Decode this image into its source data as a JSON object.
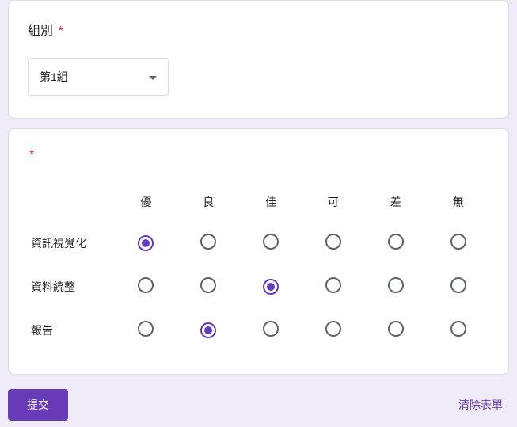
{
  "q1": {
    "label": "組別",
    "required": "*",
    "selected": "第1組"
  },
  "q2": {
    "label": "",
    "required": "*",
    "columns": [
      "優",
      "良",
      "佳",
      "可",
      "差",
      "無"
    ],
    "rows": [
      {
        "label": "資訊視覺化",
        "selected": 0
      },
      {
        "label": "資料統整",
        "selected": 2
      },
      {
        "label": "報告",
        "selected": 1
      }
    ]
  },
  "footer": {
    "submit": "提交",
    "clear": "清除表單"
  }
}
